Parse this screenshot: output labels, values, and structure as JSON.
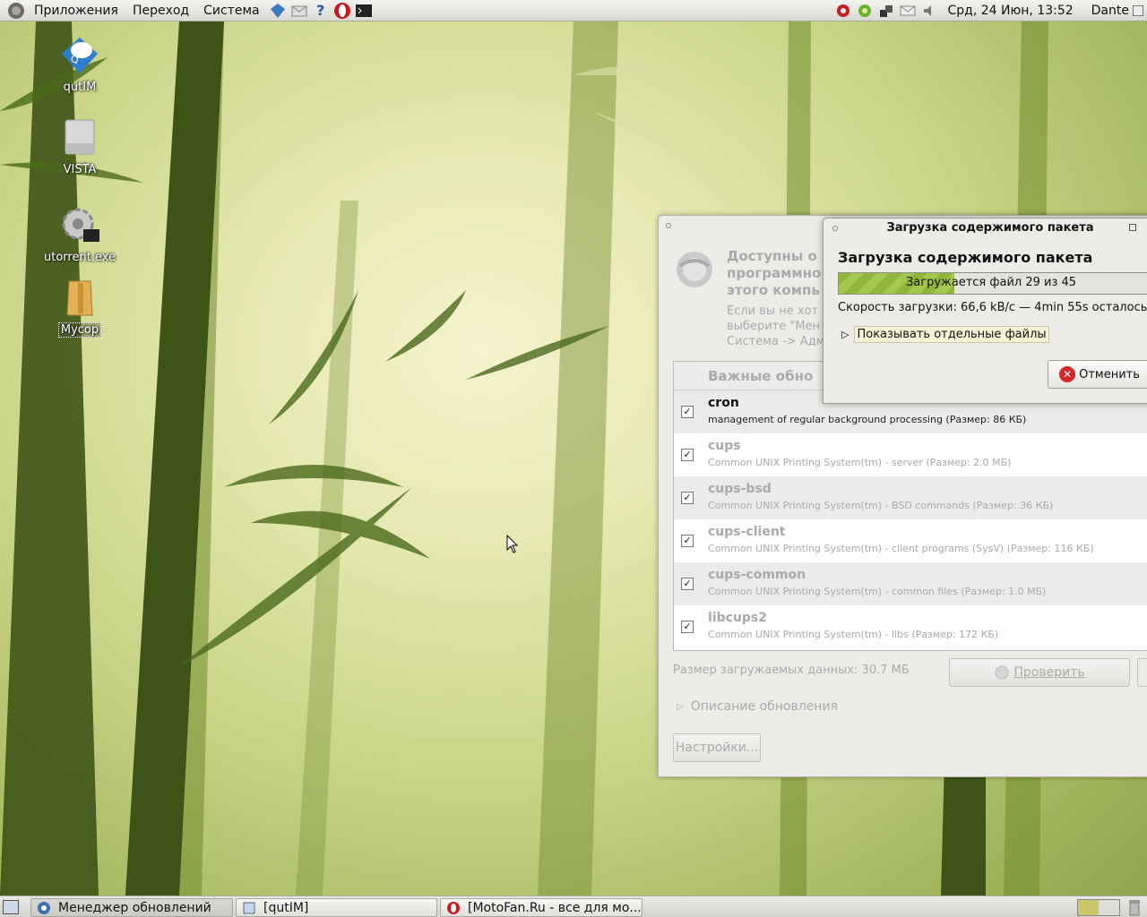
{
  "top_panel": {
    "menus": [
      "Приложения",
      "Переход",
      "Система"
    ],
    "clock": "Срд, 24 Июн, 13:52",
    "user": "Dante"
  },
  "desktop_icons": [
    {
      "label": "qutIM",
      "icon": "qutim-chat-icon"
    },
    {
      "label": "VISTA",
      "icon": "drive-icon"
    },
    {
      "label": "utorrent.exe",
      "icon": "executable-gear-icon"
    },
    {
      "label": "Мусор",
      "icon": "trash-folder-icon"
    }
  ],
  "update_manager": {
    "heading_lines": [
      "Доступны о",
      "программно",
      "этого компь"
    ],
    "subtext_lines": [
      "Если вы не хот",
      "выберите \"Мен",
      "Система -> Адм"
    ],
    "list_header": "Важные обно",
    "packages": [
      {
        "name": "cron",
        "desc": "management of regular background processing (Размер: 86 КБ)",
        "checked": true
      },
      {
        "name": "cups",
        "desc": "Common UNIX Printing System(tm) - server (Размер: 2.0 МБ)",
        "checked": true
      },
      {
        "name": "cups-bsd",
        "desc": "Common UNIX Printing System(tm) - BSD commands (Размер: 36 КБ)",
        "checked": true
      },
      {
        "name": "cups-client",
        "desc": "Common UNIX Printing System(tm) - client programs (SysV) (Размер: 116 КБ)",
        "checked": true
      },
      {
        "name": "cups-common",
        "desc": "Common UNIX Printing System(tm) - common files (Размер: 1.0 МБ)",
        "checked": true
      },
      {
        "name": "libcups2",
        "desc": "Common UNIX Printing System(tm) - libs (Размер: 172 КБ)",
        "checked": true
      }
    ],
    "download_size": "Размер загружаемых данных: 30.7 МБ",
    "check_label": "Проверить",
    "description_label": "Описание обновления",
    "settings_label": "Настройки..."
  },
  "download_dialog": {
    "title": "Загрузка содержимого пакета",
    "heading": "Загрузка содержимого пакета",
    "progress_text": "Загружается файл 29 из 45",
    "progress_fraction": 0.36,
    "speed": "Скорость загрузки: 66,6 kB/c — 4min 55s осталось",
    "show_files_label": "Показывать отдельные файлы",
    "cancel_label": "Отменить"
  },
  "taskbar": {
    "tasks": [
      {
        "label": "Менеджер обновлений",
        "icon": "update-manager-icon",
        "active": true
      },
      {
        "label": "[qutIM]",
        "icon": "qutim-icon",
        "active": false
      },
      {
        "label": "[MotoFan.Ru - все для мо...",
        "icon": "opera-icon",
        "active": false
      }
    ]
  },
  "colors": {
    "progress": "#8fb63a",
    "cancel_icon": "#d7262b"
  }
}
